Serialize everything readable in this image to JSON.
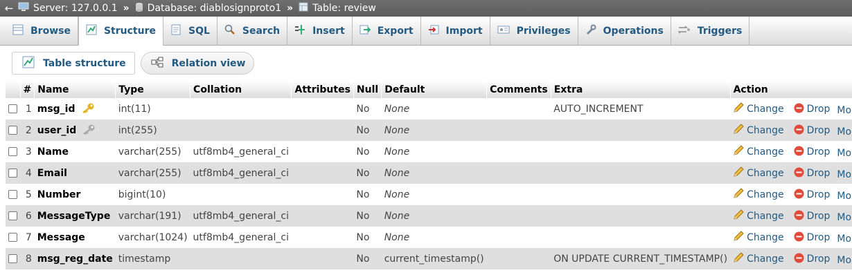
{
  "breadcrumb": {
    "back_label": "←",
    "server": "Server: 127.0.0.1",
    "database": "Database: diablosignproto1",
    "table": "Table: review",
    "separator": "»"
  },
  "tabs": [
    {
      "label": "Browse",
      "icon": "browse-icon"
    },
    {
      "label": "Structure",
      "icon": "structure-icon"
    },
    {
      "label": "SQL",
      "icon": "sql-icon"
    },
    {
      "label": "Search",
      "icon": "search-icon"
    },
    {
      "label": "Insert",
      "icon": "insert-icon"
    },
    {
      "label": "Export",
      "icon": "export-icon"
    },
    {
      "label": "Import",
      "icon": "import-icon"
    },
    {
      "label": "Privileges",
      "icon": "privileges-icon"
    },
    {
      "label": "Operations",
      "icon": "operations-icon"
    },
    {
      "label": "Triggers",
      "icon": "triggers-icon"
    }
  ],
  "subtabs": {
    "table_structure": "Table structure",
    "relation_view": "Relation view"
  },
  "columns": [
    "#",
    "Name",
    "Type",
    "Collation",
    "Attributes",
    "Null",
    "Default",
    "Comments",
    "Extra",
    "Action"
  ],
  "actions": {
    "change": "Change",
    "drop": "Drop",
    "more": "More"
  },
  "rows": [
    {
      "num": "1",
      "name": "msg_id",
      "key": "primary",
      "type": "int(11)",
      "collation": "",
      "null": "No",
      "default": "None",
      "extra": "AUTO_INCREMENT"
    },
    {
      "num": "2",
      "name": "user_id",
      "key": "index",
      "type": "int(255)",
      "collation": "",
      "null": "No",
      "default": "None",
      "extra": ""
    },
    {
      "num": "3",
      "name": "Name",
      "key": "",
      "type": "varchar(255)",
      "collation": "utf8mb4_general_ci",
      "null": "No",
      "default": "None",
      "extra": ""
    },
    {
      "num": "4",
      "name": "Email",
      "key": "",
      "type": "varchar(255)",
      "collation": "utf8mb4_general_ci",
      "null": "No",
      "default": "None",
      "extra": ""
    },
    {
      "num": "5",
      "name": "Number",
      "key": "",
      "type": "bigint(10)",
      "collation": "",
      "null": "No",
      "default": "None",
      "extra": ""
    },
    {
      "num": "6",
      "name": "MessageType",
      "key": "",
      "type": "varchar(191)",
      "collation": "utf8mb4_general_ci",
      "null": "No",
      "default": "None",
      "extra": ""
    },
    {
      "num": "7",
      "name": "Message",
      "key": "",
      "type": "varchar(1024)",
      "collation": "utf8mb4_general_ci",
      "null": "No",
      "default": "None",
      "extra": ""
    },
    {
      "num": "8",
      "name": "msg_reg_date",
      "key": "",
      "type": "timestamp",
      "collation": "",
      "null": "No",
      "default": "current_timestamp()",
      "extra": "ON UPDATE CURRENT_TIMESTAMP()"
    }
  ],
  "colors": {
    "link": "#235a81",
    "row_alt": "#dfdfdf",
    "breadcrumb_bg": "#666666"
  }
}
